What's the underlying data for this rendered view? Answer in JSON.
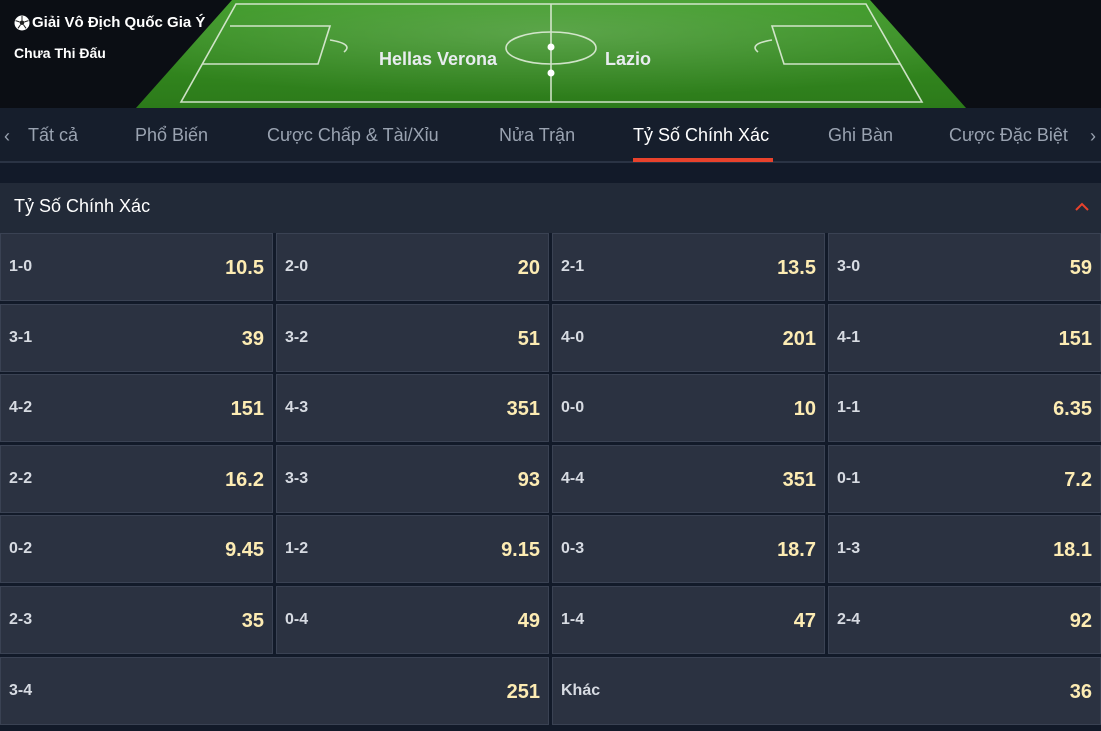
{
  "match": {
    "league": "Giải Vô Địch Quốc Gia Ý",
    "status": "Chưa Thi Đấu",
    "home_team": "Hellas Verona",
    "away_team": "Lazio"
  },
  "tabs": [
    {
      "label": "Tất cả",
      "active": false
    },
    {
      "label": "Phổ Biến",
      "active": false
    },
    {
      "label": "Cược Chấp & Tài/Xỉu",
      "active": false
    },
    {
      "label": "Nửa Trận",
      "active": false
    },
    {
      "label": "Tỷ Số Chính Xác",
      "active": true
    },
    {
      "label": "Ghi Bàn",
      "active": false
    },
    {
      "label": "Cược Đặc Biệt",
      "active": false
    }
  ],
  "nav": {
    "prev": "‹",
    "next": "›"
  },
  "market": {
    "title": "Tỷ Số Chính Xác",
    "rows": [
      [
        {
          "score": "1-0",
          "odd": "10.5"
        },
        {
          "score": "2-0",
          "odd": "20"
        },
        {
          "score": "2-1",
          "odd": "13.5"
        },
        {
          "score": "3-0",
          "odd": "59"
        }
      ],
      [
        {
          "score": "3-1",
          "odd": "39"
        },
        {
          "score": "3-2",
          "odd": "51"
        },
        {
          "score": "4-0",
          "odd": "201"
        },
        {
          "score": "4-1",
          "odd": "151"
        }
      ],
      [
        {
          "score": "4-2",
          "odd": "151"
        },
        {
          "score": "4-3",
          "odd": "351"
        },
        {
          "score": "0-0",
          "odd": "10"
        },
        {
          "score": "1-1",
          "odd": "6.35"
        }
      ],
      [
        {
          "score": "2-2",
          "odd": "16.2"
        },
        {
          "score": "3-3",
          "odd": "93"
        },
        {
          "score": "4-4",
          "odd": "351"
        },
        {
          "score": "0-1",
          "odd": "7.2"
        }
      ],
      [
        {
          "score": "0-2",
          "odd": "9.45"
        },
        {
          "score": "1-2",
          "odd": "9.15"
        },
        {
          "score": "0-3",
          "odd": "18.7"
        },
        {
          "score": "1-3",
          "odd": "18.1"
        }
      ],
      [
        {
          "score": "2-3",
          "odd": "35"
        },
        {
          "score": "0-4",
          "odd": "49"
        },
        {
          "score": "1-4",
          "odd": "47"
        },
        {
          "score": "2-4",
          "odd": "92"
        }
      ],
      [
        {
          "score": "3-4",
          "odd": "251"
        },
        {
          "score": "Khác",
          "odd": "36"
        }
      ]
    ]
  },
  "colors": {
    "accent": "#e8422c",
    "odds_text": "#fdecb3",
    "pitch_green": "#2f8a1e"
  }
}
